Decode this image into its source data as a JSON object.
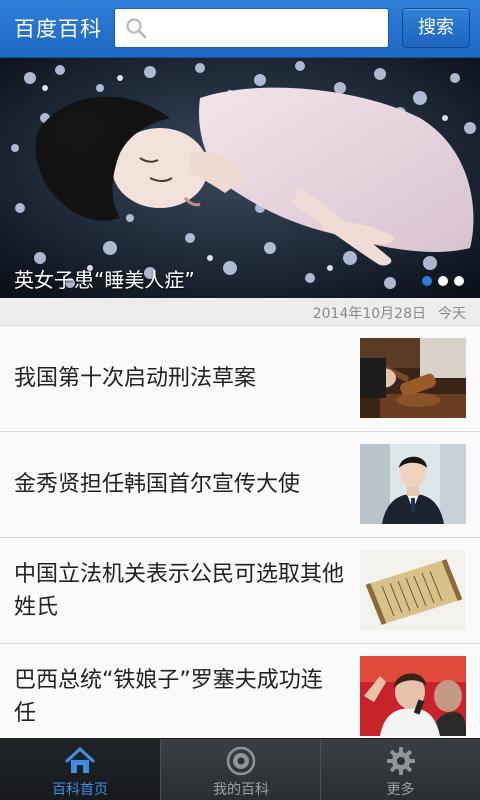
{
  "header": {
    "logo": "百度百科",
    "search_placeholder": "",
    "search_button": "搜索"
  },
  "banner": {
    "caption": "英女子患“睡美人症”",
    "slides_total": 3,
    "active_slide": 1
  },
  "feed": {
    "date": "2014年10月28日",
    "today": "今天",
    "items": [
      {
        "title": "我国第十次启动刑法草案"
      },
      {
        "title": "金秀贤担任韩国首尔宣传大使"
      },
      {
        "title": "中国立法机关表示公民可选取其他姓氏"
      },
      {
        "title": "巴西总统“铁娘子”罗塞夫成功连任"
      }
    ]
  },
  "tabbar": {
    "tabs": [
      {
        "label": "百科首页",
        "icon": "home-icon",
        "active": true
      },
      {
        "label": "我的百科",
        "icon": "my-baike-icon",
        "active": false
      },
      {
        "label": "更多",
        "icon": "gear-icon",
        "active": false
      }
    ]
  },
  "colors": {
    "header_blue": "#2f7fd8",
    "active_tab": "#3c8ee6",
    "tabbar_bg": "#2a2e33"
  }
}
